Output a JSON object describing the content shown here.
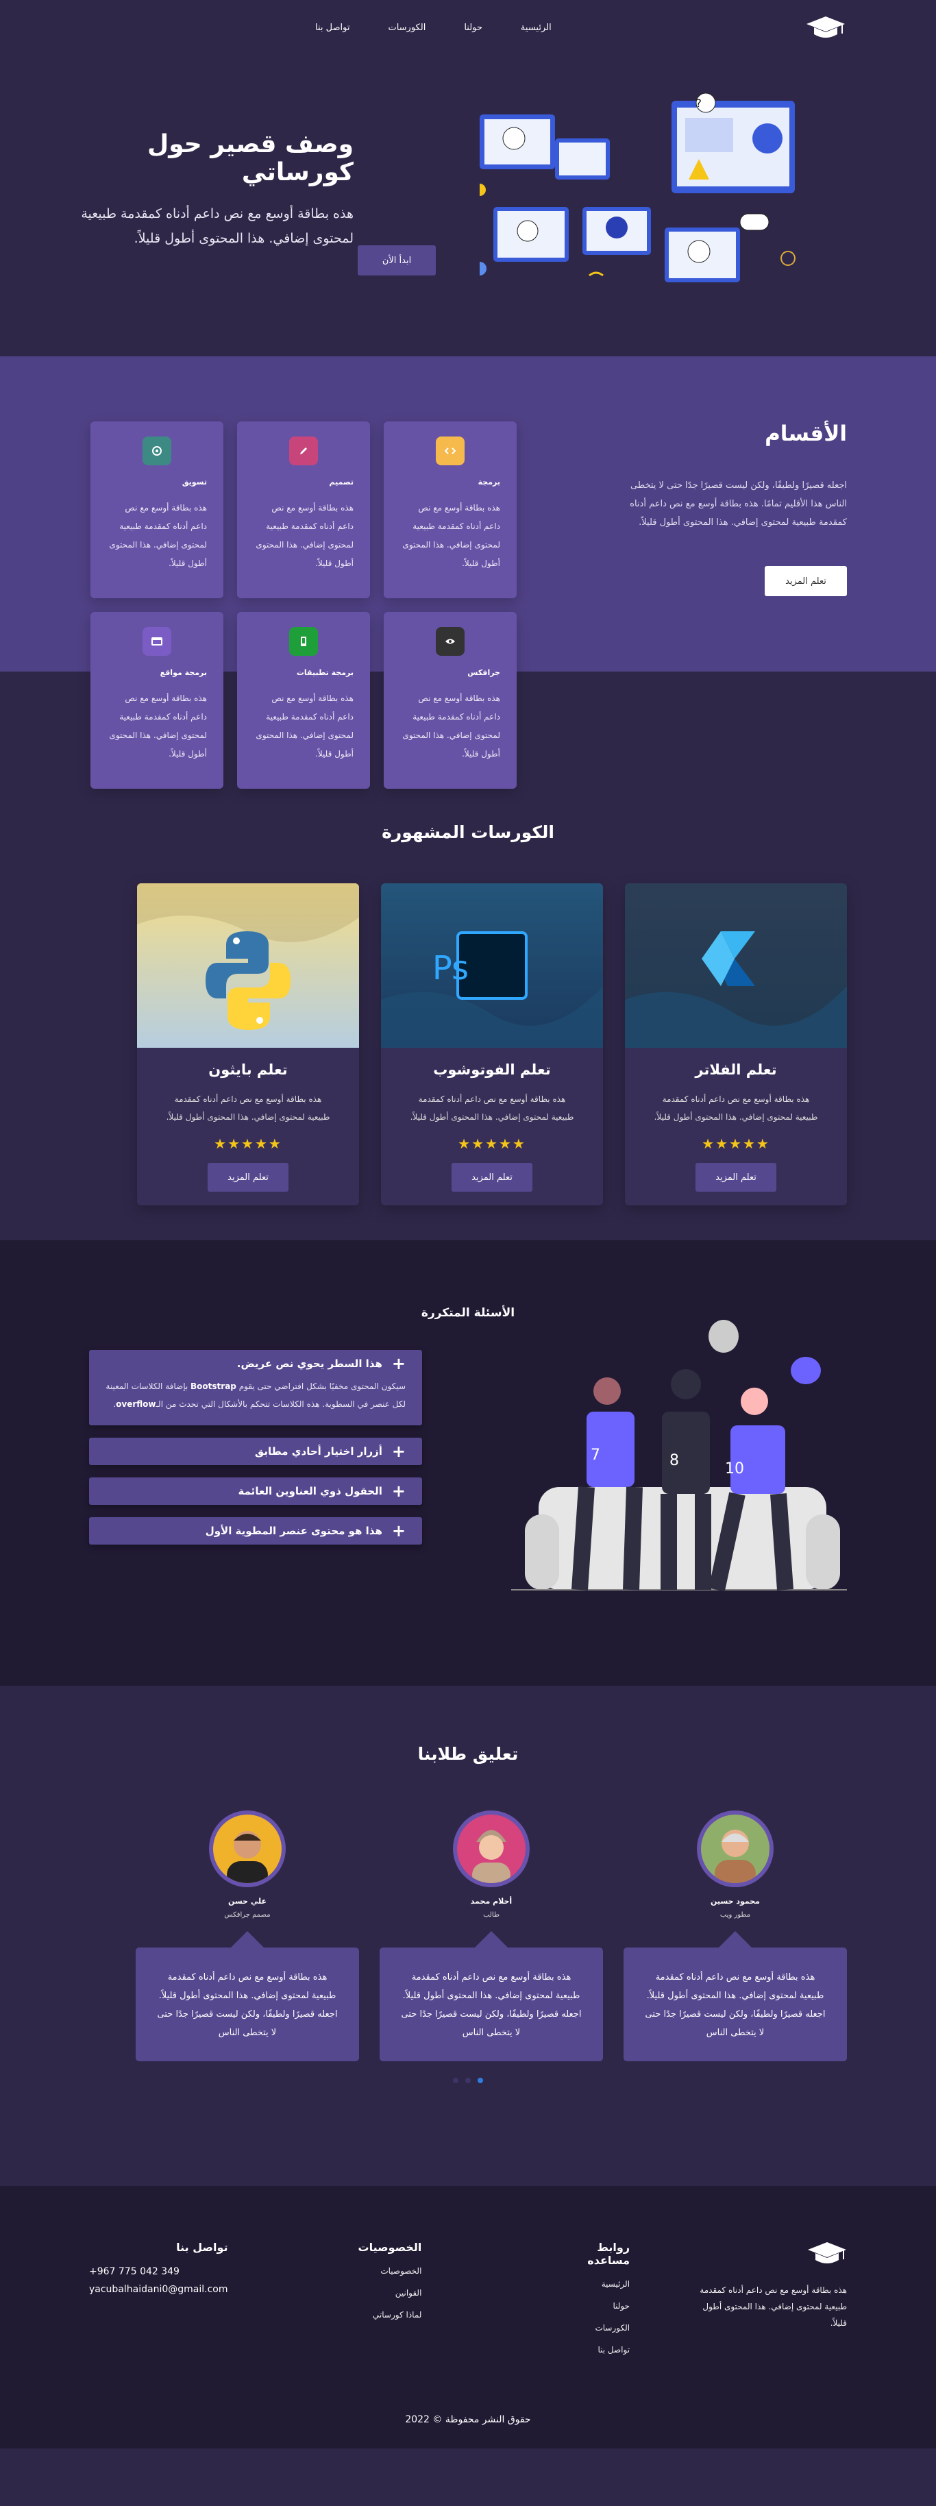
{
  "nav": {
    "links": [
      "الرئيسية",
      "حولنا",
      "الكورسات",
      "تواصل بنا"
    ]
  },
  "hero": {
    "title": "وصف قصير حول كورساتي",
    "text": "هذه بطاقة أوسع مع نص داعم أدناه كمقدمة طبيعية لمحتوى إضافي. هذا المحتوى أطول قليلاً.",
    "button": "ابدأ الأن"
  },
  "departments": {
    "title": "الأقسام",
    "text": "اجعله قصيرًا ولطيفًا، ولكن ليست قصيرًا جدًا حتى لا يتخطى الناس هذا الأقليم تمامًا. هذه بطاقة أوسع مع نص داعم أدناه كمقدمة طبيعية لمحتوى إضافي. هذا المحتوى أطول قليلاً.",
    "button": "تعلم المزيد",
    "cards": [
      {
        "title": "برمجة",
        "text": "هذه بطاقة أوسع مع نص داعم أدناه كمقدمة طبيعية لمحتوى إضافي. هذا المحتوى أطول قليلاً.",
        "icon": "code-icon",
        "color": "#f6b94c"
      },
      {
        "title": "تصميم",
        "text": "هذه بطاقة أوسع مع نص داعم أدناه كمقدمة طبيعية لمحتوى إضافي. هذا المحتوى أطول قليلاً.",
        "icon": "pen-icon",
        "color": "#c8457c"
      },
      {
        "title": "تسويق",
        "text": "هذه بطاقة أوسع مع نص داعم أدناه كمقدمة طبيعية لمحتوى إضافي. هذا المحتوى أطول قليلاً.",
        "icon": "target-icon",
        "color": "#3d8a84"
      },
      {
        "title": "جرافكس",
        "text": "هذه بطاقة أوسع مع نص داعم أدناه كمقدمة طبيعية لمحتوى إضافي. هذا المحتوى أطول قليلاً.",
        "icon": "eye-icon",
        "color": "#333333"
      },
      {
        "title": "برمجة تطبيقات",
        "text": "هذه بطاقة أوسع مع نص داعم أدناه كمقدمة طبيعية لمحتوى إضافي. هذا المحتوى أطول قليلاً.",
        "icon": "mobile-icon",
        "color": "#1f9f3a"
      },
      {
        "title": "برمجة مواقع",
        "text": "هذه بطاقة أوسع مع نص داعم أدناه كمقدمة طبيعية لمحتوى إضافي. هذا المحتوى أطول قليلاً.",
        "icon": "window-icon",
        "color": "#7b5cc4"
      }
    ]
  },
  "courses": {
    "title": "الكورسات المشهورة",
    "items": [
      {
        "title": "تعلم الفلاتر",
        "text": "هذه بطاقة أوسع مع نص داعم أدناه كمقدمة طبيعية لمحتوى إضافي. هذا المحتوى أطول قليلاً.",
        "stars": "★★★★★",
        "button": "تعلم المزيد",
        "icon": "flutter-logo"
      },
      {
        "title": "تعلم الفوتوشوب",
        "text": "هذه بطاقة أوسع مع نص داعم أدناه كمقدمة طبيعية لمحتوى إضافي. هذا المحتوى أطول قليلاً.",
        "stars": "★★★★★",
        "button": "تعلم المزيد",
        "icon": "photoshop-logo"
      },
      {
        "title": "تعلم بايثون",
        "text": "هذه بطاقة أوسع مع نص داعم أدناه كمقدمة طبيعية لمحتوى إضافي. هذا المحتوى أطول قليلاً.",
        "stars": "★★★★★",
        "button": "تعلم المزيد",
        "icon": "python-logo"
      }
    ]
  },
  "faq": {
    "title": "الأسئلة المتكررة",
    "items": [
      {
        "q": "هذا السطر يحوي نص عريض.",
        "a1": "سيكون المحتوى مخفيًا بشكل افتراضي حتى يقوم ",
        "bold1": "Bootstrap",
        "a2": " بإضافة الكلاسات المعينة لكل عنصر في السطوية. هذه الكلاسات تتحكم بالأشكال التي تحدث من الـ",
        "bold2": "overflow",
        "a3": "."
      },
      {
        "q": "أزرار اختيار أحادي مطابق"
      },
      {
        "q": "الحقول ذوي العناوين العائمة"
      },
      {
        "q": "هذا هو محتوى عنصر المطوية الأول"
      }
    ],
    "jersey_numbers": [
      "7",
      "8",
      "10"
    ]
  },
  "testimonials": {
    "title": "تعليق طلابنا",
    "items": [
      {
        "name": "محمود حسين",
        "role": "مطور ويب",
        "text": "هذه بطاقة أوسع مع نص داعم أدناه كمقدمة طبيعية لمحتوى إضافي. هذا المحتوى أطول قليلاً. اجعله قصيرًا ولطيفًا، ولكن ليست قصيرًا جدًا حتى لا يتخطى الناس"
      },
      {
        "name": "أحلام محمد",
        "role": "طالب",
        "text": "هذه بطاقة أوسع مع نص داعم أدناه كمقدمة طبيعية لمحتوى إضافي. هذا المحتوى أطول قليلاً. اجعله قصيرًا ولطيفًا، ولكن ليست قصيرًا جدًا حتى لا يتخطى الناس"
      },
      {
        "name": "علي حسن",
        "role": "مصمم جرافكس",
        "text": "هذه بطاقة أوسع مع نص داعم أدناه كمقدمة طبيعية لمحتوى إضافي. هذا المحتوى أطول قليلاً. اجعله قصيرًا ولطيفًا، ولكن ليست قصيرًا جدًا حتى لا يتخطى الناس"
      }
    ]
  },
  "footer": {
    "about": "هذه بطاقة أوسع مع نص داعم أدناه كمقدمة طبيعية لمحتوى إضافي. هذا المحتوى أطول قليلاً.",
    "help_title": "روابط مساعده",
    "help_links": [
      "الرئيسية",
      "حولنا",
      "الكورسات",
      "تواصل بنا"
    ],
    "privacy_title": "الخصوصيات",
    "privacy_links": [
      "الخصوصيات",
      "القوانين",
      "لماذا كورساتي"
    ],
    "contact_title": "تواصل بنا",
    "phone": "+967 775 042 349",
    "email": "yacubalhaidani0@gmail.com",
    "copyright": "حقوق النشر محفوظة © 2022"
  },
  "colors": {
    "accent": "#56488f",
    "section": "#4f4185",
    "dark": "#211a33",
    "page": "#2f2748"
  }
}
